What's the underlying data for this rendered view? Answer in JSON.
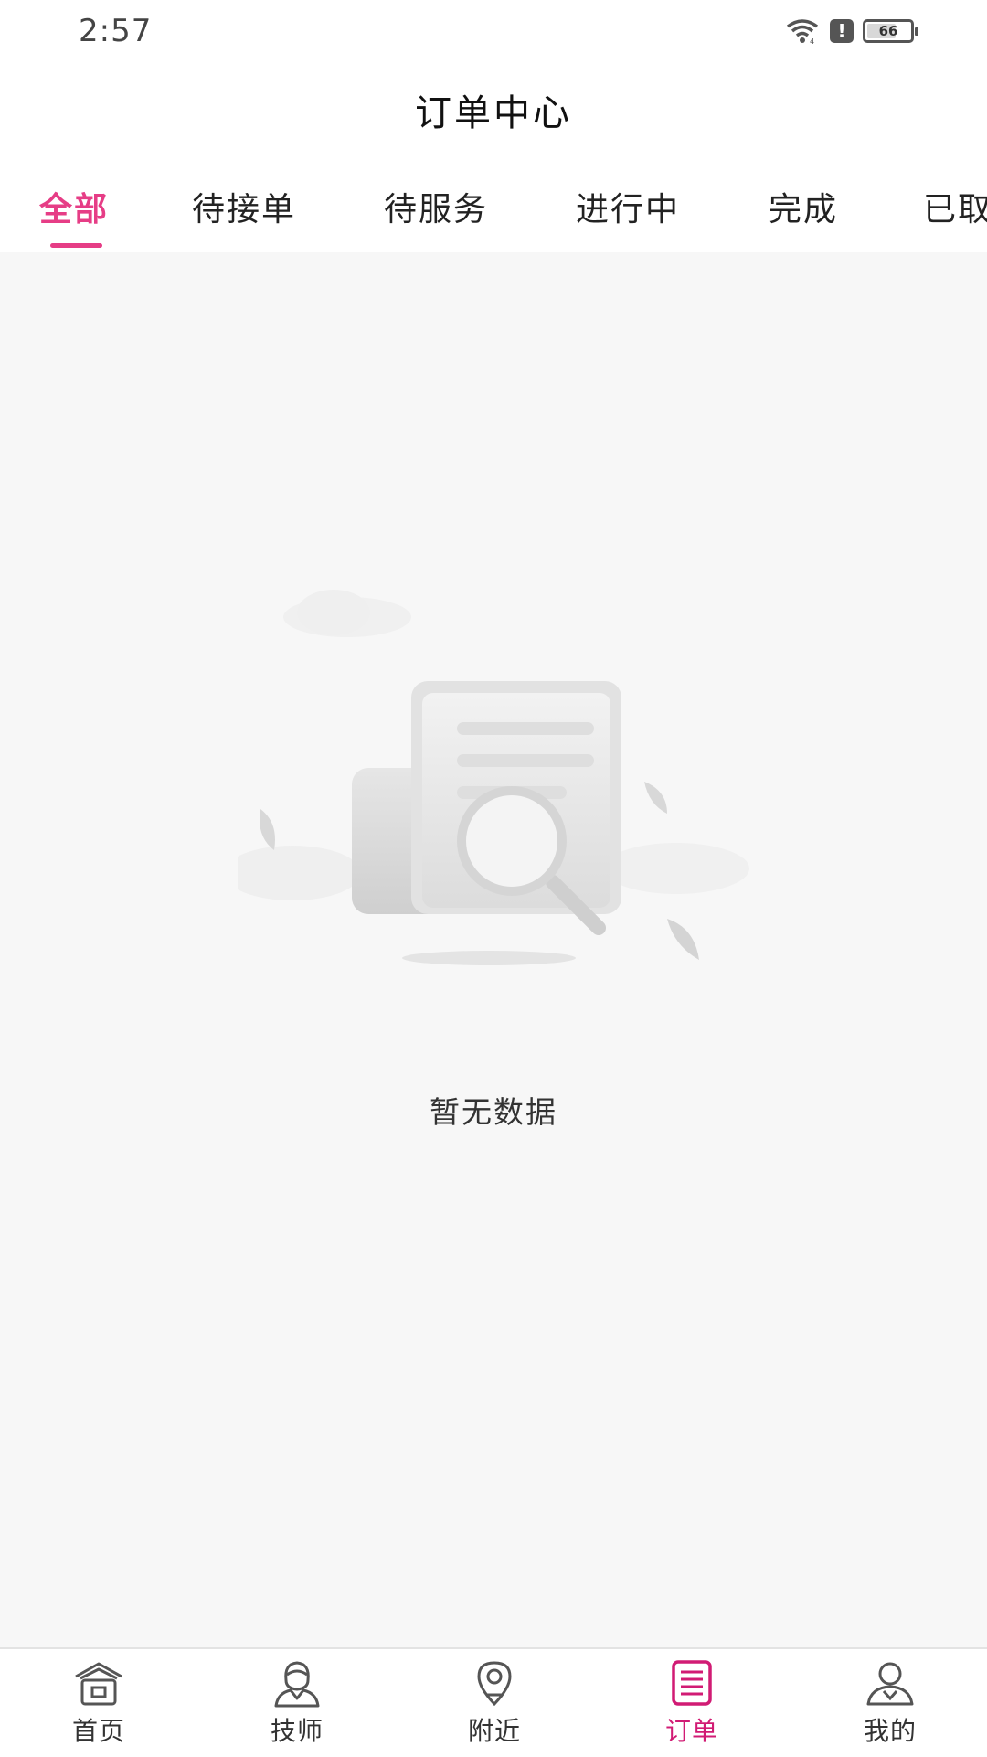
{
  "status_bar": {
    "time": "2:57",
    "battery": "66"
  },
  "header": {
    "title": "订单中心"
  },
  "tabs": [
    {
      "label": "全部",
      "active": true
    },
    {
      "label": "待接单",
      "active": false
    },
    {
      "label": "待服务",
      "active": false
    },
    {
      "label": "进行中",
      "active": false
    },
    {
      "label": "完成",
      "active": false
    },
    {
      "label": "已取消",
      "active": false
    }
  ],
  "empty": {
    "message": "暂无数据"
  },
  "bottom_nav": [
    {
      "label": "首页",
      "icon": "home-icon",
      "active": false
    },
    {
      "label": "技师",
      "icon": "technician-icon",
      "active": false
    },
    {
      "label": "附近",
      "icon": "location-pin-icon",
      "active": false
    },
    {
      "label": "订单",
      "icon": "order-list-icon",
      "active": true
    },
    {
      "label": "我的",
      "icon": "profile-icon",
      "active": false
    }
  ],
  "colors": {
    "accent": "#e63d86",
    "nav_active": "#d11b74",
    "background": "#f7f7f7"
  }
}
